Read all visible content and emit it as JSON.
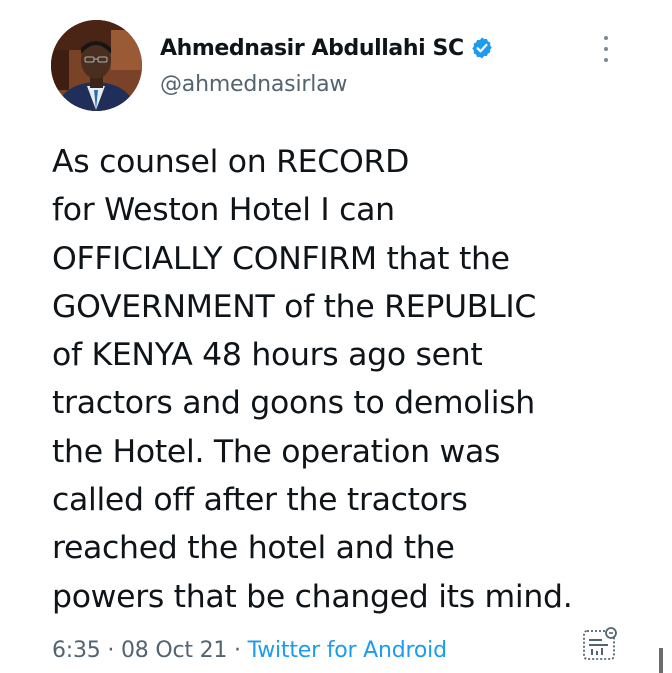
{
  "author": {
    "name": "Ahmednasir Abdullahi SC",
    "handle": "@ahmednasirlaw",
    "verified": true,
    "avatar_icon": "profile-photo"
  },
  "tweet": {
    "lines": [
      "As counsel on RECORD",
      "for Weston Hotel I can",
      "OFFICIALLY CONFIRM that the",
      "GOVERNMENT of the REPUBLIC",
      "of KENYA 48 hours ago sent",
      "tractors and goons to demolish",
      "the Hotel. The operation was",
      "called off after the tractors",
      "reached the hotel and the",
      "powers that be changed its mind."
    ],
    "time": "6:35",
    "date": "08 Oct 21",
    "separator": "·",
    "source": "Twitter for Android"
  },
  "icons": {
    "more": "more-vertical-icon",
    "verified": "verified-badge-icon",
    "analytics": "view-analytics-icon"
  },
  "colors": {
    "text": "#0f1419",
    "secondary": "#536471",
    "accent": "#1d9bf0"
  }
}
